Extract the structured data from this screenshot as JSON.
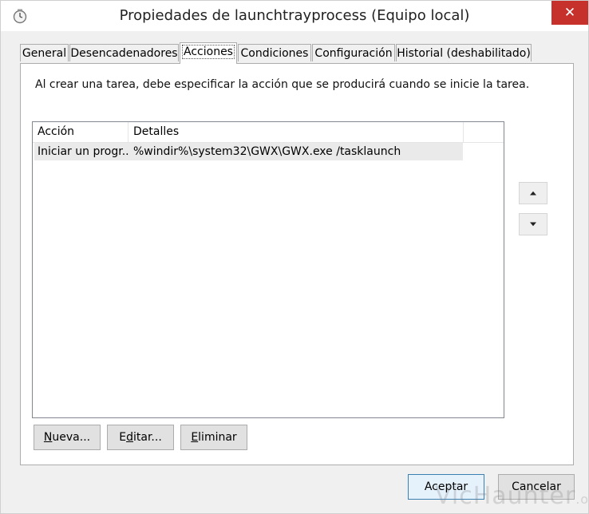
{
  "window": {
    "title": "Propiedades de launchtrayprocess (Equipo local)",
    "close_glyph": "✕",
    "icon": "clock-icon"
  },
  "tabs": [
    {
      "label": "General",
      "active": false
    },
    {
      "label": "Desencadenadores",
      "active": false
    },
    {
      "label": "Acciones",
      "active": true
    },
    {
      "label": "Condiciones",
      "active": false
    },
    {
      "label": "Configuración",
      "active": false
    },
    {
      "label": "Historial (deshabilitado)",
      "active": false
    }
  ],
  "panel": {
    "description": "Al crear una tarea, debe especificar la acción que se producirá cuando se inicie la tarea."
  },
  "actions_list": {
    "columns": [
      "Acción",
      "Detalles"
    ],
    "rows": [
      {
        "action": "Iniciar un progr...",
        "details": "%windir%\\system32\\GWX\\GWX.exe /tasklaunch"
      }
    ]
  },
  "buttons": {
    "new_prefix": "",
    "new_mnemonic": "N",
    "new_rest": "ueva...",
    "edit_prefix": "E",
    "edit_mnemonic": "d",
    "edit_rest": "itar...",
    "delete_prefix": "",
    "delete_mnemonic": "E",
    "delete_rest": "liminar",
    "accept": "Aceptar",
    "cancel": "Cancelar",
    "move_up_icon": "triangle-up-icon",
    "move_down_icon": "triangle-down-icon"
  },
  "watermark": {
    "main": "VicHaunter",
    "suffix": ".org"
  },
  "colors": {
    "close_button": "#c7312b",
    "default_button_border": "#3c7fb1",
    "selected_row": "#eaeaea"
  }
}
